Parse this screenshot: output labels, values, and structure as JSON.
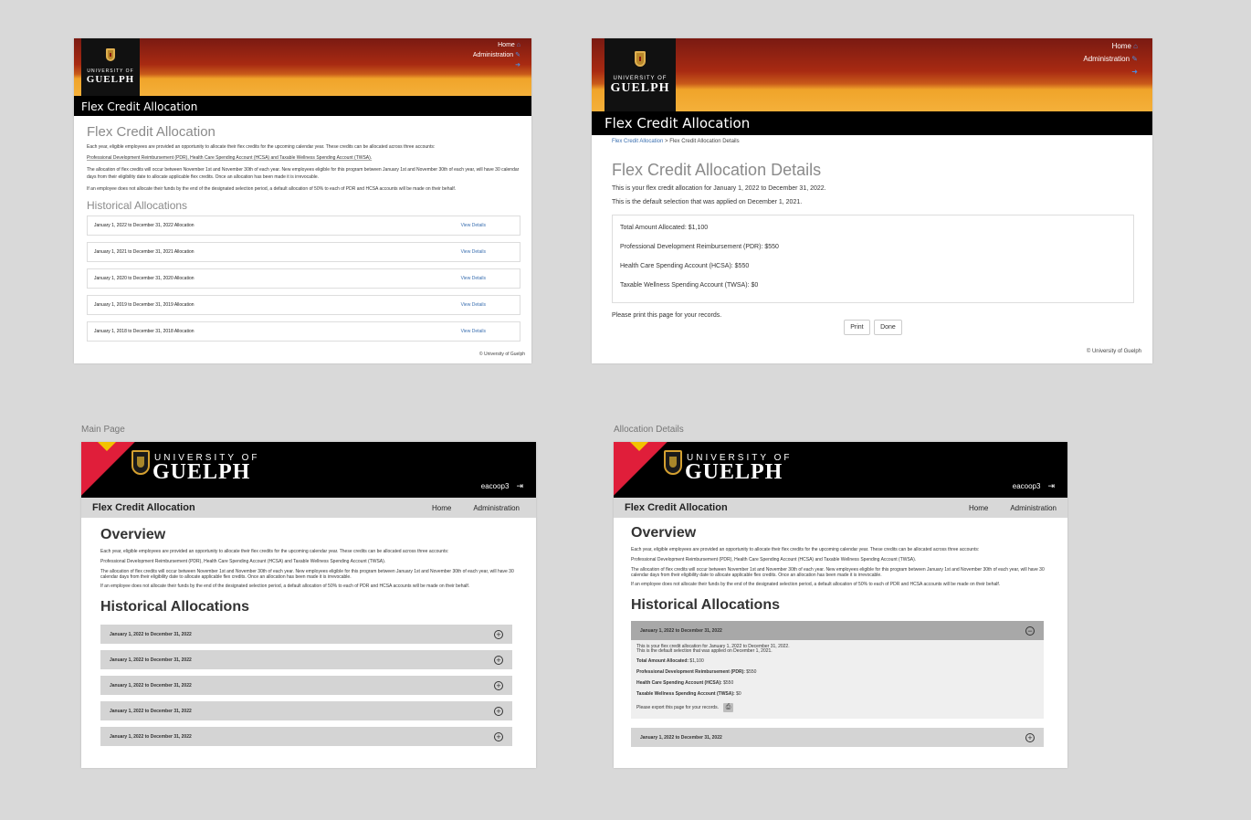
{
  "old_main": {
    "nav": {
      "home": "Home",
      "admin": "Administration"
    },
    "logo": {
      "line1": "UNIVERSITY OF",
      "line2": "GUELPH"
    },
    "bar_title": "Flex Credit Allocation",
    "title": "Flex Credit Allocation",
    "p1": "Each year, eligible employees are provided an opportunity to allocate their flex credits for the upcoming calendar year. These credits can be allocated across three accounts:",
    "p2": "Professional Development Reimbursement (PDR), Health Care Spending Account (HCSA) and Taxable Wellness Spending Account (TWSA).",
    "p3": "The allocation of flex credits will occur between November 1st and November 30th of each year. New employees eligible for this program between January 1st and November 30th of each year, will have 30 calendar days from their eligibility date to allocate applicable flex credits. Once an allocation has been made it is irrevocable.",
    "p4": "If an employee does not allocate their funds by the end of the designated selection period, a default allocation of 50% to each of PDR and HCSA accounts will be made on their behalf.",
    "hist_title": "Historical Allocations",
    "rows": [
      {
        "label": "January 1, 2022 to December 31, 2022 Allocation",
        "link": "View Details"
      },
      {
        "label": "January 1, 2021 to December 31, 2021 Allocation",
        "link": "View Details"
      },
      {
        "label": "January 1, 2020 to December 31, 2020 Allocation",
        "link": "View Details"
      },
      {
        "label": "January 1, 2019 to December 31, 2019 Allocation",
        "link": "View Details"
      },
      {
        "label": "January 1, 2018 to December 31, 2018 Allocation",
        "link": "View Details"
      }
    ],
    "footer": "© University of Guelph"
  },
  "old_details": {
    "nav": {
      "home": "Home",
      "admin": "Administration"
    },
    "logo": {
      "line1": "UNIVERSITY OF",
      "line2": "GUELPH"
    },
    "bar_title": "Flex Credit Allocation",
    "breadcrumb": {
      "link": "Flex Credit Allocation",
      "sep": " > ",
      "current": "Flex Credit Allocation Details"
    },
    "title": "Flex Credit Allocation Details",
    "p1": "This is your flex credit allocation for January 1, 2022 to December 31, 2022.",
    "p2": "This is the default selection that was applied on December 1, 2021.",
    "items": [
      "Total Amount Allocated: $1,100",
      "Professional Development Reimbursement (PDR): $550",
      "Health Care Spending Account (HCSA): $550",
      "Taxable Wellness Spending Account (TWSA): $0"
    ],
    "print_note": "Please print this page for your records.",
    "print_btn": "Print",
    "done_btn": "Done",
    "footer": "© University of Guelph"
  },
  "labels": {
    "main": "Main Page",
    "details": "Allocation Details"
  },
  "new_main": {
    "logo": {
      "line1": "UNIVERSITY OF",
      "line2": "GUELPH"
    },
    "user": "eacoop3",
    "sub_title": "Flex Credit Allocation",
    "nav_home": "Home",
    "nav_admin": "Administration",
    "overview": "Overview",
    "p1": "Each year, eligible employees are provided an opportunity to allocate their flex credits for the upcoming calendar year. These credits can be allocated across three accounts:",
    "p2": "Professional Development Reimbursement (PDR), Health Care Spending Account (HCSA) and Taxable Wellness Spending Account (TWSA).",
    "p3": "The allocation of flex credits will occur between November 1st and November 30th of each year. New employees eligible for this program between January 1st and November 30th of each year, will have 30 calendar days from their eligibility date to allocate applicable flex credits. Once an allocation has been made it is irrevocable.",
    "p4": "If an employee does not allocate their funds by the end of the designated selection period, a default allocation of 50% to each of PDR and HCSA accounts will be made on their behalf.",
    "hist_title": "Historical Allocations",
    "rows": [
      "January 1, 2022 to December 31, 2022",
      "January 1, 2022 to December 31, 2022",
      "January 1, 2022 to December 31, 2022",
      "January 1, 2022 to December 31, 2022",
      "January 1, 2022 to December 31, 2022"
    ]
  },
  "new_details": {
    "logo": {
      "line1": "UNIVERSITY OF",
      "line2": "GUELPH"
    },
    "user": "eacoop3",
    "sub_title": "Flex Credit Allocation",
    "nav_home": "Home",
    "nav_admin": "Administration",
    "overview": "Overview",
    "p1": "Each year, eligible employees are provided an opportunity to allocate their flex credits for the upcoming calendar year. These credits can be allocated across three accounts:",
    "p2": "Professional Development Reimbursement (PDR), Health Care Spending Account (HCSA) and Taxable Wellness Spending Account (TWSA).",
    "p3": "The allocation of flex credits will occur between November 1st and November 30th of each year. New employees eligible for this program between January 1st and November 30th of each year, will have 30 calendar days from their eligibility date to allocate applicable flex credits. Once an allocation has been made it is irrevocable.",
    "p4": "If an employee does not allocate their funds by the end of the designated selection period, a default allocation of 50% to each of PDR and HCSA accounts will be made on their behalf.",
    "hist_title": "Historical Allocations",
    "open_row": "January 1, 2022 to December 31, 2022",
    "open_p1": "This is your flex credit allocation for January 1, 2022 to December 31, 2022.",
    "open_p2": "This is the default selection that was applied on December 1, 2021.",
    "items": [
      {
        "k": "Total Amount Allocated:",
        "v": " $1,100"
      },
      {
        "k": "Professional Development Reimbursement (PDR):",
        "v": " $550"
      },
      {
        "k": "Health Care Spending Account (HCSA):",
        "v": " $550"
      },
      {
        "k": "Taxable Wellness Spending Account (TWSA):",
        "v": " $0"
      }
    ],
    "export_note": "Please export this page for your records.",
    "closed_row": "January 1, 2022 to December 31, 2022"
  }
}
